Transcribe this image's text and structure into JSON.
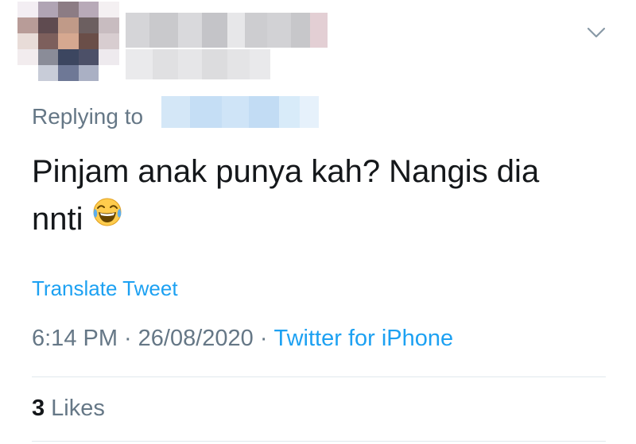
{
  "tweet": {
    "replying_label": "Replying to",
    "text_line1": "Pinjam anak punya kah? Nangis dia",
    "text_line2": "nnti",
    "emoji_icon": "face-with-tears-of-joy-icon",
    "translate_label": "Translate Tweet",
    "time": "6:14 PM",
    "separator": "·",
    "date": "26/08/2020",
    "source": "Twitter for iPhone",
    "likes_count": "3",
    "likes_label": "Likes"
  },
  "colors": {
    "link": "#1da1f2",
    "secondary_text": "#657786",
    "primary_text": "#14171a",
    "divider": "#e1e8ed"
  },
  "icons": {
    "more": "chevron-down-icon",
    "avatar": "pixelated-avatar"
  }
}
